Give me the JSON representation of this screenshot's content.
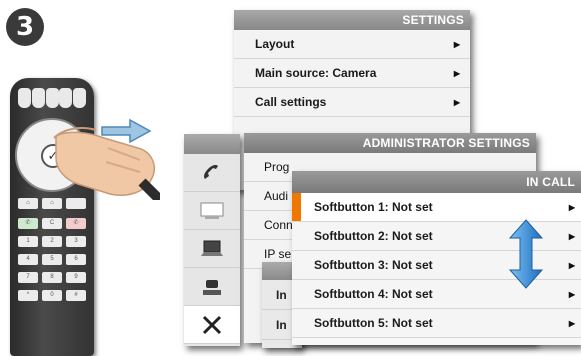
{
  "step": "3",
  "settings": {
    "title": "SETTINGS",
    "items": [
      {
        "label": "Layout",
        "arrow": "▶"
      },
      {
        "label": "Main source: Camera",
        "arrow": "▶"
      },
      {
        "label": "Call settings",
        "arrow": "▶"
      }
    ]
  },
  "admin": {
    "title": "ADMINISTRATOR SETTINGS",
    "items": [
      {
        "label": "Prog"
      },
      {
        "label": "Audi"
      },
      {
        "label": "Conn"
      },
      {
        "label": "IP se"
      }
    ]
  },
  "stack": {
    "items": [
      {
        "label": "In"
      },
      {
        "label": "In"
      }
    ]
  },
  "incall": {
    "title": "IN CALL",
    "items": [
      {
        "label": "Softbutton 1: Not set",
        "arrow": "▶",
        "selected": true
      },
      {
        "label": "Softbutton 2: Not set",
        "arrow": "▶"
      },
      {
        "label": "Softbutton 3: Not set",
        "arrow": "▶"
      },
      {
        "label": "Softbutton 4: Not set",
        "arrow": "▶"
      },
      {
        "label": "Softbutton 5: Not set",
        "arrow": "▶"
      }
    ]
  },
  "icons": [
    "phone-icon",
    "presentation-icon",
    "laptop-icon",
    "camera-icon",
    "tools-icon"
  ],
  "colors": {
    "accent": "#f07800",
    "scroll_arrow": "#2a88d8",
    "header": "#8a8a8a"
  }
}
